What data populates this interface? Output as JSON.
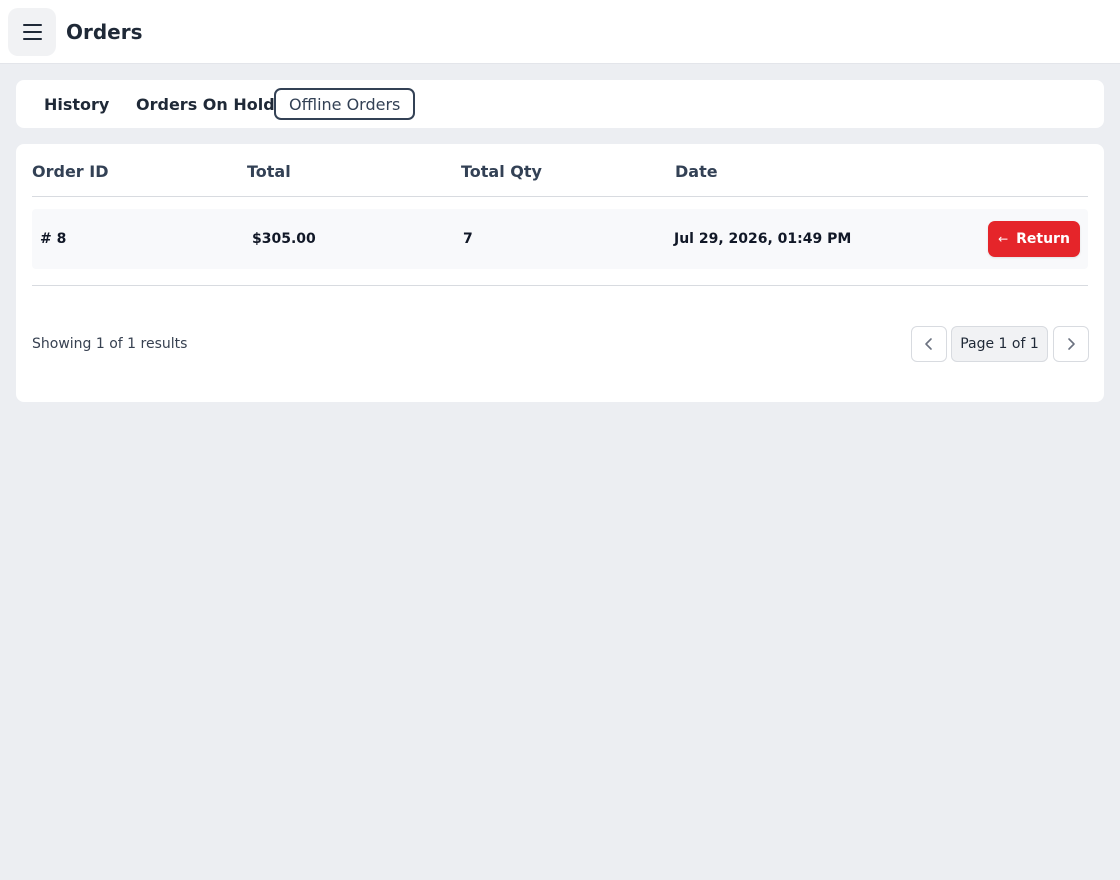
{
  "header": {
    "title": "Orders",
    "menu_icon": "hamburger-menu-icon"
  },
  "tabs": [
    {
      "label": "History",
      "active": false
    },
    {
      "label": "Orders On Hold",
      "active": false
    },
    {
      "label": "Offline Orders",
      "active": true
    }
  ],
  "table": {
    "columns": [
      "Order ID",
      "Total",
      "Total Qty",
      "Date"
    ],
    "rows": [
      {
        "order_id": "# 8",
        "total": "$305.00",
        "total_qty": "7",
        "date": "Jul 29, 2026, 01:49 PM",
        "action_label": "Return",
        "action_icon": "arrow-left-icon"
      }
    ]
  },
  "pagination": {
    "results_text": "Showing 1 of 1 results",
    "page_label": "Page 1 of 1",
    "prev_icon": "chevron-left-icon",
    "next_icon": "chevron-right-icon"
  },
  "colors": {
    "background": "#eceef2",
    "return_button": "#e5252a",
    "active_tab_border": "#334155"
  }
}
